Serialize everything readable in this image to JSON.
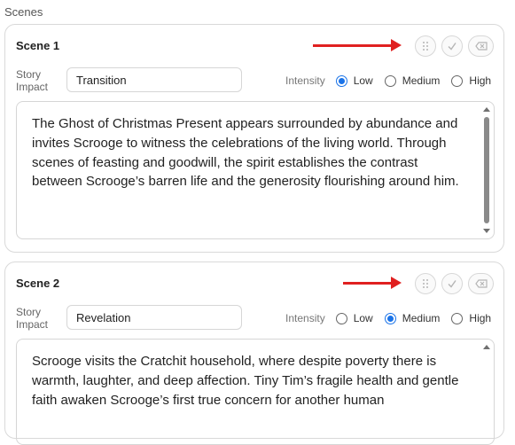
{
  "section": {
    "title": "Scenes"
  },
  "labels": {
    "story_impact": "Story Impact",
    "intensity": "Intensity"
  },
  "intensity_options": [
    "Low",
    "Medium",
    "High"
  ],
  "scenes": [
    {
      "title": "Scene 1",
      "story_impact": "Transition",
      "intensity_selected": "Low",
      "text": "The Ghost of Christmas Present appears surrounded by abundance and invites Scrooge to witness the celebrations of the living world. Through scenes of feasting and goodwill, the spirit establishes the contrast between Scrooge’s barren life and the generosity flourishing around him."
    },
    {
      "title": "Scene 2",
      "story_impact": "Revelation",
      "intensity_selected": "Medium",
      "text": "Scrooge visits the Cratchit household, where despite poverty there is warmth, laughter, and deep affection. Tiny Tim’s fragile health and gentle faith awaken Scrooge’s first true concern for another human"
    }
  ],
  "colors": {
    "annotation_arrow": "#e02020",
    "radio_selected": "#1a73e8"
  },
  "icons": [
    "drag-handle-icon",
    "check-icon",
    "eraser-icon"
  ]
}
